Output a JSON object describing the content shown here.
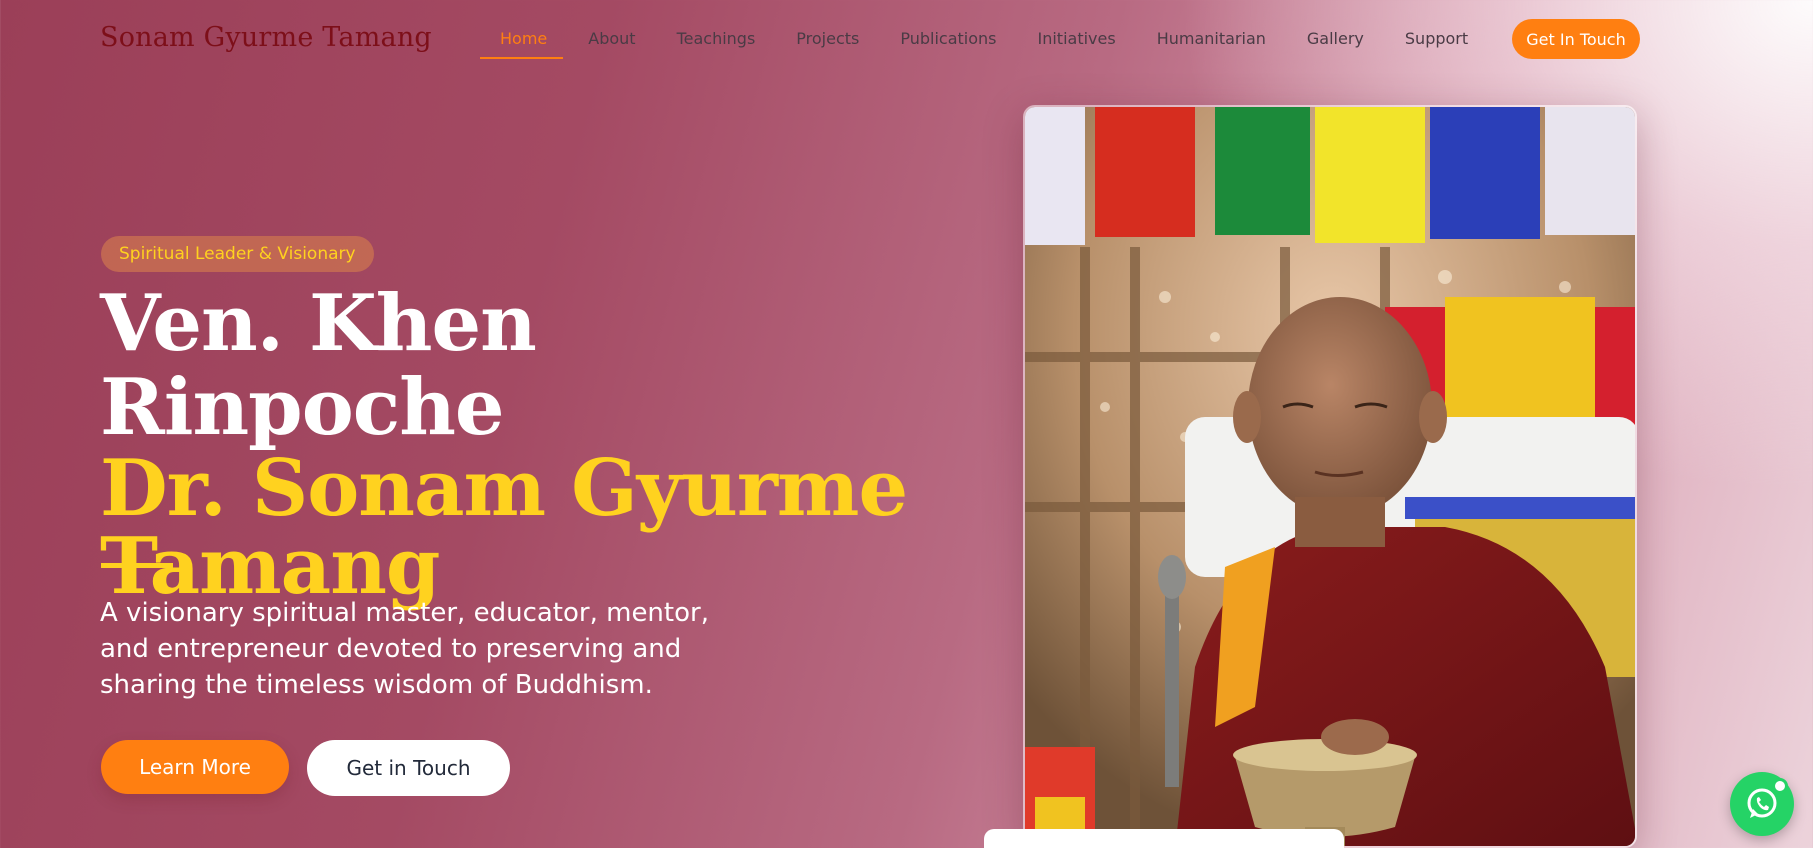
{
  "brand": "Sonam Gyurme Tamang",
  "nav": {
    "items": [
      {
        "label": "Home",
        "active": true
      },
      {
        "label": "About"
      },
      {
        "label": "Teachings"
      },
      {
        "label": "Projects"
      },
      {
        "label": "Publications"
      },
      {
        "label": "Initiatives"
      },
      {
        "label": "Humanitarian"
      },
      {
        "label": "Gallery"
      },
      {
        "label": "Support"
      }
    ],
    "cta": "Get In Touch"
  },
  "hero": {
    "badge": "Spiritual Leader & Visionary",
    "title_line1": "Ven. Khen Rinpoche",
    "title_line2": "Dr. Sonam Gyurme",
    "title_line3": "Tamang",
    "lead": "A visionary spiritual master, educator, mentor, and entrepreneur devoted to preserving and sharing the timeless wisdom of Buddhism.",
    "primary_button": "Learn More",
    "secondary_button": "Get in Touch"
  },
  "colors": {
    "accent": "#ff7f11",
    "highlight": "#ffd21f",
    "brand": "#7d0f19",
    "whatsapp": "#25d366"
  },
  "icons": {
    "chat": "whatsapp-icon"
  }
}
